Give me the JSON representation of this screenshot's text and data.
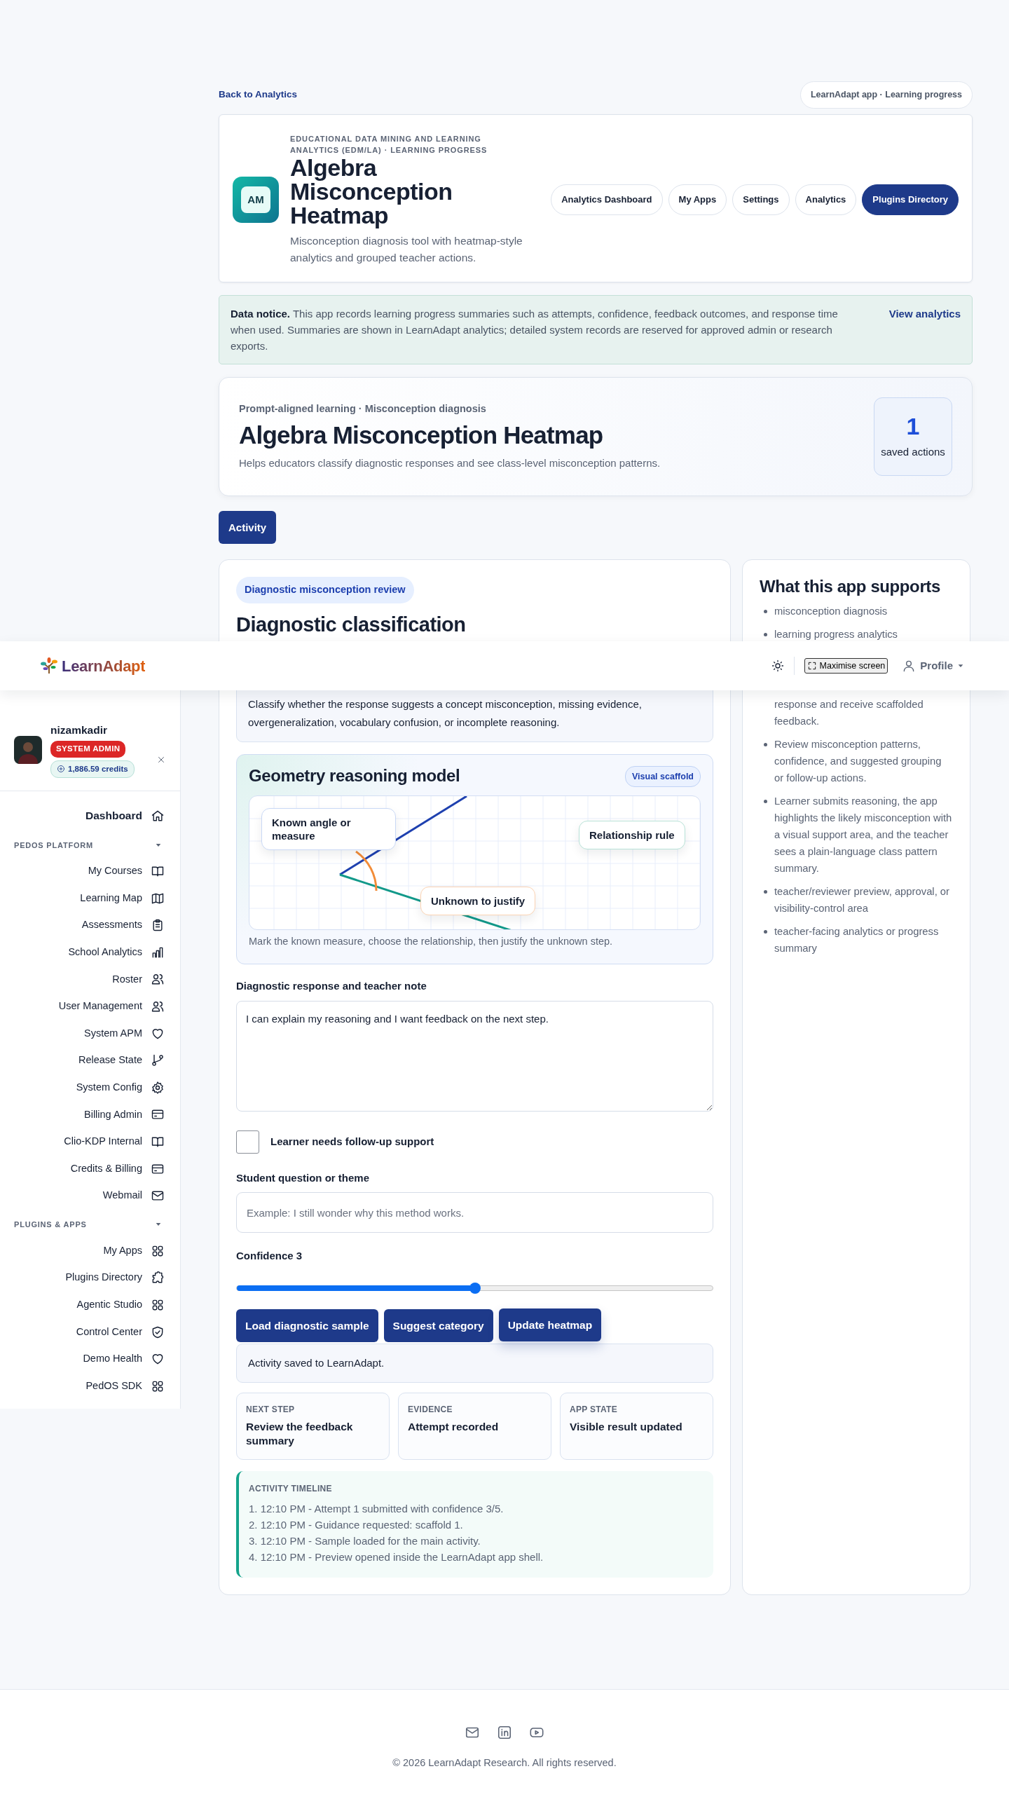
{
  "top_bar": {
    "back_link": "Back to Analytics",
    "context_chip": "LearnAdapt app · Learning progress"
  },
  "app_header": {
    "icon_text": "AM",
    "eyebrow": "EDUCATIONAL DATA MINING AND LEARNING ANALYTICS (EDM/LA) · LEARNING PROGRESS",
    "title": "Algebra Misconception Heatmap",
    "description": "Misconception diagnosis tool with heatmap-style analytics and grouped teacher actions.",
    "nav": [
      {
        "label": "Analytics Dashboard",
        "selected": false
      },
      {
        "label": "My Apps",
        "selected": false
      },
      {
        "label": "Settings",
        "selected": false
      },
      {
        "label": "Analytics",
        "selected": false
      },
      {
        "label": "Plugins Directory",
        "selected": true
      }
    ]
  },
  "notice": {
    "text": "**Data notice.** This app records learning progress summaries such as attempts, confidence, feedback outcomes, and response time when used. Summaries are shown in LearnAdapt analytics; detailed system records are reserved for approved admin or research exports.",
    "link": "View analytics"
  },
  "hero": {
    "eyebrow": "Prompt-aligned learning · Misconception diagnosis",
    "title": "Algebra Misconception Heatmap",
    "description": "Helps educators classify diagnostic responses and see class-level misconception patterns.",
    "stat_value": "1",
    "stat_label": "saved actions"
  },
  "tabs": [
    {
      "label": "Activity",
      "selected": true
    }
  ],
  "activity": {
    "tag": "Diagnostic misconception review",
    "title": "Diagnostic classification",
    "instructions": "Classify whether the response suggests a concept misconception, missing evidence, overgeneralization, vocabulary confusion, or incomplete reasoning.",
    "model": {
      "title": "Geometry reasoning model",
      "badge": "Visual scaffold",
      "labels": [
        "Known angle or measure",
        "Relationship rule",
        "Unknown to justify"
      ],
      "caption": "Mark the known measure, choose the relationship, then justify the unknown step."
    },
    "response": {
      "label": "Diagnostic response and teacher note",
      "value": "I can explain my reasoning and I want feedback on the next step."
    },
    "follow_up": {
      "label": "Learner needs follow-up support",
      "checked": false
    },
    "question": {
      "label": "Student question or theme",
      "placeholder": "Example: I still wonder why this method works."
    },
    "confidence": {
      "label": "Confidence 3",
      "level": 0.5
    },
    "buttons": [
      "Load diagnostic sample",
      "Suggest category",
      "Update heatmap"
    ],
    "status": "Activity saved to LearnAdapt.",
    "summary_cards": [
      {
        "label": "NEXT STEP",
        "value": "Review the feedback summary"
      },
      {
        "label": "EVIDENCE",
        "value": "Attempt recorded"
      },
      {
        "label": "APP STATE",
        "value": "Visible result updated"
      }
    ],
    "timeline": {
      "title": "ACTIVITY TIMELINE",
      "entries": [
        "1. 12:10 PM - Attempt 1 submitted with confidence 3/5.",
        "2. 12:10 PM - Guidance requested: scaffold 1.",
        "3. 12:10 PM - Sample loaded for the main activity.",
        "4. 12:10 PM - Preview opened inside the LearnAdapt app shell."
      ]
    }
  },
  "supports": {
    "title": "What this app supports",
    "items": [
      "misconception diagnosis",
      "learning progress analytics",
      "response and receive scaffolded feedback.",
      "Review misconception patterns, confidence, and suggested grouping or follow-up actions.",
      "Learner submits reasoning, the app highlights the likely misconception with a visual support area, and the teacher sees a plain-language class pattern summary.",
      "teacher/reviewer preview, approval, or visibility-control area",
      "teacher-facing analytics or progress summary"
    ]
  },
  "navbar": {
    "brand": "LearnAdapt",
    "maximise": "Maximise screen",
    "profile": "Profile"
  },
  "sidebar": {
    "user": {
      "name": "nizamkadir",
      "role": "SYSTEM ADMIN",
      "credits": "1,886.59 credits"
    },
    "dashboard": "Dashboard",
    "sections": [
      {
        "title": "PEDOS PLATFORM",
        "expanded": true,
        "items": [
          "My Courses",
          "Learning Map",
          "Assessments",
          "School Analytics",
          "Roster",
          "User Management",
          "System APM",
          "Release State",
          "System Config",
          "Billing Admin",
          "Clio-KDP Internal",
          "Credits & Billing",
          "Webmail"
        ]
      },
      {
        "title": "PLUGINS & APPS",
        "expanded": true,
        "items": [
          "My Apps",
          "Plugins Directory",
          "Agentic Studio",
          "Control Center",
          "Demo Health",
          "PedOS SDK"
        ]
      }
    ]
  },
  "footer": {
    "copyright": "© 2026 LearnAdapt Research. All rights reserved."
  }
}
